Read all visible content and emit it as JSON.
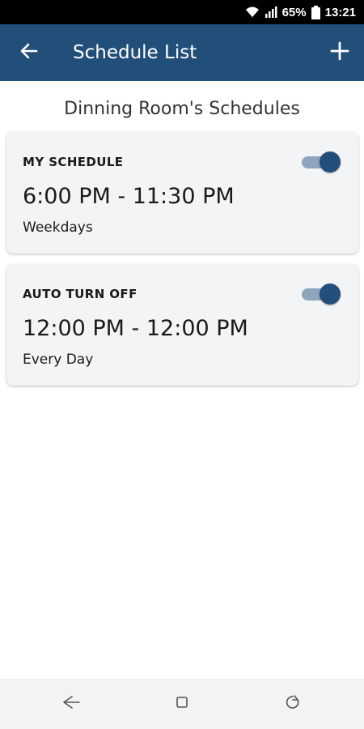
{
  "status_bar": {
    "battery_percent": "65%",
    "time": "13:21",
    "icons": [
      "wifi-icon",
      "signal-icon",
      "battery-icon"
    ]
  },
  "app_bar": {
    "title": "Schedule List",
    "back_icon": "arrow-left-icon",
    "add_icon": "plus-icon"
  },
  "page": {
    "subtitle": "Dinning Room's Schedules"
  },
  "schedules": [
    {
      "name": "MY SCHEDULE",
      "time": "6:00 PM - 11:30 PM",
      "days": "Weekdays",
      "enabled": true
    },
    {
      "name": "AUTO TURN OFF",
      "time": "12:00 PM - 12:00 PM",
      "days": "Every Day",
      "enabled": true
    }
  ],
  "nav_bar": {
    "icons": [
      "back-nav-icon",
      "home-nav-icon",
      "recents-nav-icon"
    ]
  },
  "colors": {
    "primary": "#224e7a",
    "toggle_track": "#8ea5bd",
    "card_bg": "#f2f4f6"
  }
}
